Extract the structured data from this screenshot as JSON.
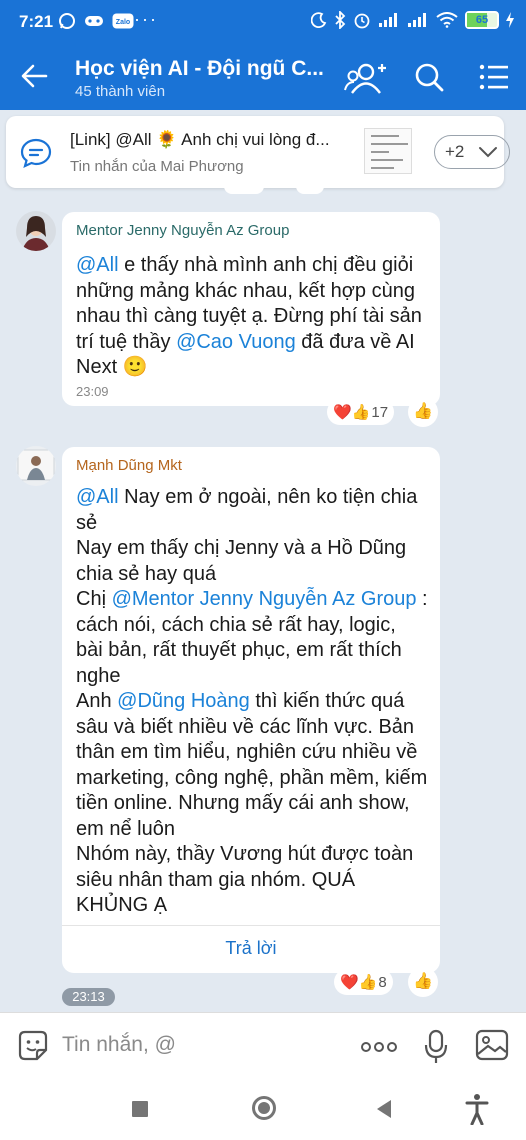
{
  "status_bar": {
    "time": "7:21",
    "battery": "65",
    "battery_level": 0.65,
    "more": "···"
  },
  "header": {
    "title": "Học viện AI - Đội ngũ C...",
    "member_count": "45 thành viên"
  },
  "pinned": {
    "text": "[Link] @All 🌻 Anh chị vui lòng đ...",
    "from": "Tin nhắn của Mai Phương",
    "more": "+2"
  },
  "messages": [
    {
      "sender": "Mentor Jenny Nguyễn Az Group",
      "sender_color": "#2a6a68",
      "parts": [
        {
          "t": "@All",
          "m": true
        },
        {
          "t": " e thấy nhà mình anh chị đều giỏi những mảng khác nhau, kết hợp cùng nhau thì càng tuyệt ạ. Đừng phí tài sản trí tuệ thầy "
        },
        {
          "t": "@Cao Vuong",
          "m": true
        },
        {
          "t": " đã đưa về AI Next 🙂"
        }
      ],
      "time": "23:09",
      "reactions": {
        "icons": "❤️👍",
        "count": "17"
      }
    },
    {
      "sender": "Mạnh Dũng Mkt",
      "sender_color": "#b5651d",
      "parts": [
        {
          "t": "@All",
          "m": true
        },
        {
          "t": " Nay em ở ngoài, nên ko tiện chia sẻ\nNay em thấy chị Jenny và a Hồ Dũng chia sẻ hay quá\nChị "
        },
        {
          "t": "@Mentor Jenny Nguyễn Az Group",
          "m": true
        },
        {
          "t": " : cách nói, cách chia sẻ rất hay, logic, bài bản, rất thuyết phục, em rất thích nghe\nAnh "
        },
        {
          "t": "@Dũng Hoàng",
          "m": true
        },
        {
          "t": "  thì kiến thức quá sâu và biết nhiều về các lĩnh vực. Bản thân em tìm hiểu, nghiên cứu nhiều về marketing, công nghệ, phần mềm, kiếm tiền online. Nhưng mấy cái anh show, em nể luôn\nNhóm này, thầy Vương hút được toàn siêu nhân tham gia nhóm. QUÁ KHỦNG Ạ"
        }
      ],
      "reply_label": "Trả lời",
      "time": "23:13",
      "reactions": {
        "icons": "❤️👍",
        "count": "8"
      }
    }
  ],
  "like_icon": "👍",
  "composer": {
    "placeholder": "Tin nhắn, @"
  },
  "colors": {
    "header_blue": "#1a73d6",
    "mention": "#1b82d8",
    "chat_bg": "#e2e9f1"
  },
  "icons": [
    "back-arrow-icon",
    "add-member-icon",
    "search-icon",
    "menu-icon",
    "chat-bubble-icon",
    "chevron-down-icon",
    "sticker-icon",
    "more-icon",
    "microphone-icon",
    "image-icon",
    "nav-square-icon",
    "nav-circle-icon",
    "nav-back-icon",
    "accessibility-icon"
  ]
}
